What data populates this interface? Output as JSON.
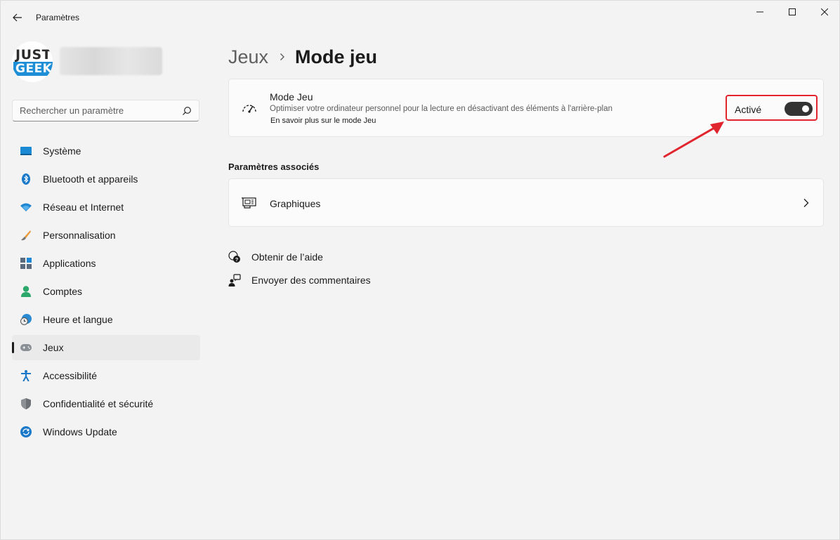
{
  "window": {
    "title": "Paramètres",
    "controls": {
      "minimize": "minimize-icon",
      "maximize": "maximize-icon",
      "close": "close-icon"
    }
  },
  "profile": {
    "logo_top": "JUST",
    "logo_bottom": "GEEK"
  },
  "search": {
    "placeholder": "Rechercher un paramètre"
  },
  "sidebar": {
    "items": [
      {
        "label": "Système",
        "icon": "system-icon"
      },
      {
        "label": "Bluetooth et appareils",
        "icon": "bluetooth-icon"
      },
      {
        "label": "Réseau et Internet",
        "icon": "wifi-icon"
      },
      {
        "label": "Personnalisation",
        "icon": "brush-icon"
      },
      {
        "label": "Applications",
        "icon": "apps-icon"
      },
      {
        "label": "Comptes",
        "icon": "account-icon"
      },
      {
        "label": "Heure et langue",
        "icon": "clock-globe-icon"
      },
      {
        "label": "Jeux",
        "icon": "gamepad-icon",
        "active": true
      },
      {
        "label": "Accessibilité",
        "icon": "accessibility-icon"
      },
      {
        "label": "Confidentialité et sécurité",
        "icon": "shield-icon"
      },
      {
        "label": "Windows Update",
        "icon": "update-icon"
      }
    ]
  },
  "breadcrumb": {
    "parent": "Jeux",
    "current": "Mode jeu"
  },
  "game_mode": {
    "title": "Mode Jeu",
    "description": "Optimiser votre ordinateur personnel pour la lecture en désactivant des éléments à l'arrière-plan",
    "link": "En savoir plus sur le mode Jeu",
    "toggle_label": "Activé",
    "toggle_on": true
  },
  "related": {
    "title": "Paramètres associés",
    "graphics_label": "Graphiques"
  },
  "help": {
    "get_help": "Obtenir de l’aide",
    "feedback": "Envoyer des commentaires"
  },
  "colors": {
    "accent": "#0067c0",
    "highlight": "#e0252e",
    "toggle_on": "#333333"
  }
}
